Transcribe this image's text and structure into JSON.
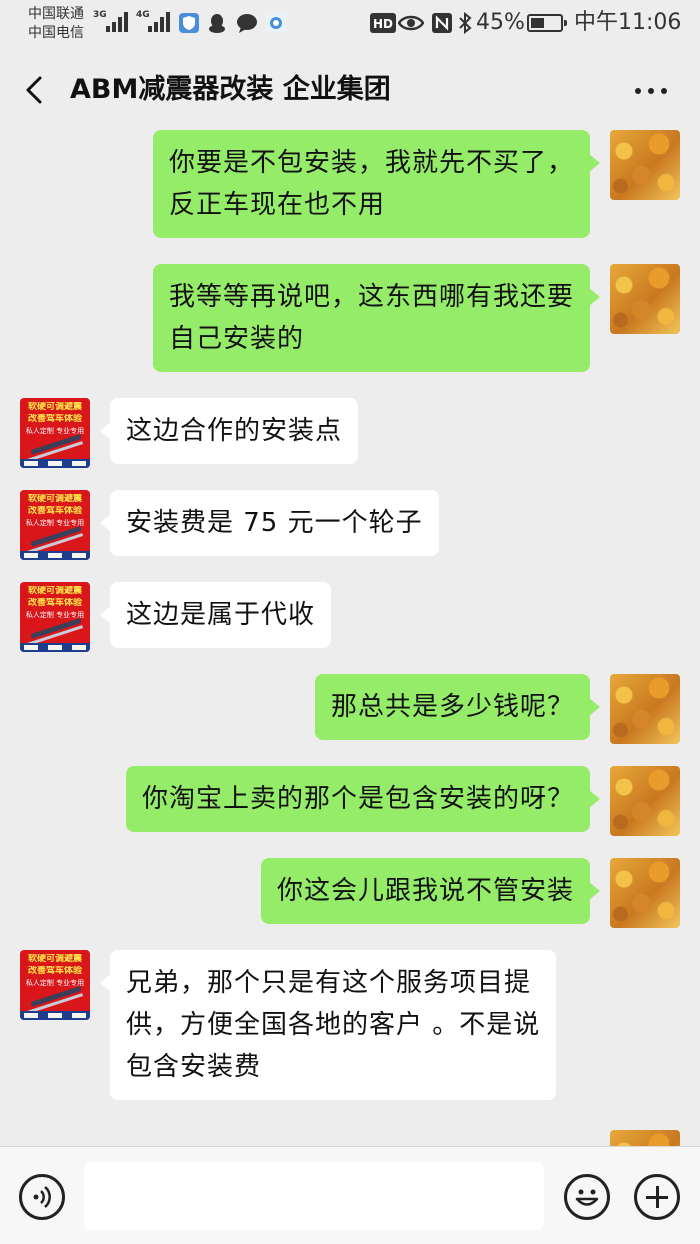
{
  "status_bar": {
    "carrier_1": "中国联通",
    "carrier_2": "中国电信",
    "sig_1": "3G",
    "sig_2": "4G",
    "hd": "HD",
    "battery_percent": "45%",
    "battery_level": 0.45,
    "time": "中午11:06",
    "icons": [
      "shield-icon",
      "qq-icon",
      "chat-bubble-icon",
      "camera-icon",
      "eye-icon",
      "nfc-icon",
      "bluetooth-icon"
    ]
  },
  "nav": {
    "title": "ABM减震器改装 企业集团"
  },
  "shop_avatar": {
    "line1": "软硬可调避震",
    "line2": "改善驾车体验",
    "line3": "私人定制 专业专用"
  },
  "messages": [
    {
      "side": "right",
      "avatar": "autumn",
      "text": "你要是不包安装，我就先不买了，\n反正车现在也不用"
    },
    {
      "side": "right",
      "avatar": "autumn",
      "text": "我等等再说吧，这东西哪有我还要\n自己安装的"
    },
    {
      "side": "left",
      "avatar": "shop",
      "text": "这边合作的安装点"
    },
    {
      "side": "left",
      "avatar": "shop",
      "text": "安装费是 75 元一个轮子"
    },
    {
      "side": "left",
      "avatar": "shop",
      "text": "这边是属于代收"
    },
    {
      "side": "right",
      "avatar": "autumn",
      "text": "那总共是多少钱呢？"
    },
    {
      "side": "right",
      "avatar": "autumn",
      "text": "你淘宝上卖的那个是包含安装的呀？"
    },
    {
      "side": "right",
      "avatar": "autumn",
      "text": "你这会儿跟我说不管安装"
    },
    {
      "side": "left",
      "avatar": "shop",
      "text": "兄弟，那个只是有这个服务项目提\n供，方便全国各地的客户 。不是说\n包含安装费"
    }
  ],
  "input": {
    "value": "",
    "placeholder": ""
  },
  "colors": {
    "background": "#ededed",
    "sent_bubble": "#95ec69",
    "received_bubble": "#ffffff"
  }
}
